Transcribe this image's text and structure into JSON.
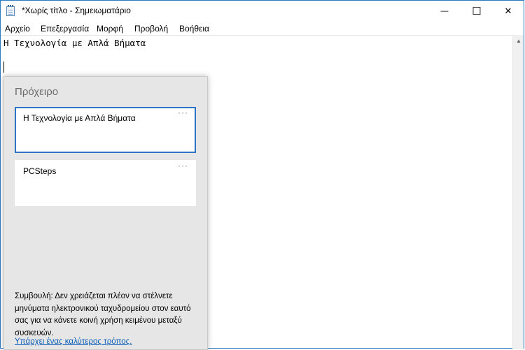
{
  "window": {
    "title": "*Χωρίς τίτλο - Σημειωματάριο",
    "minimize_glyph": "—",
    "maximize_glyph": "☐",
    "close_glyph": "✕"
  },
  "menu": {
    "items": [
      {
        "label": "Αρχείο"
      },
      {
        "label": "Επεξεργασία"
      },
      {
        "label": "Μορφή"
      },
      {
        "label": "Προβολή"
      },
      {
        "label": "Βοήθεια"
      }
    ]
  },
  "editor": {
    "content": "Η Τεχνολογία με Απλά Βήματα"
  },
  "clipboard": {
    "title": "Πρόχειρο",
    "items": [
      {
        "text": "Η Τεχνολογία με Απλά Βήματα",
        "more": "···",
        "selected": true
      },
      {
        "text": "PCSteps",
        "more": "···",
        "selected": false
      }
    ],
    "tip": "Συμβουλή: Δεν χρειάζεται πλέον να στέλνετε μηνύματα ηλεκτρονικού ταχυδρομείου στον εαυτό σας για να κάνετε κοινή χρήση κειμένου μεταξύ συσκευών.",
    "link": "Υπάρχει ένας καλύτερος τρόπος."
  },
  "colors": {
    "accent": "#2c74c8",
    "link": "#0a5db8",
    "panel_bg": "#e6e6e6"
  },
  "icons": {
    "app": "notepad-icon",
    "scroll_up": "scroll-up-arrow-icon"
  }
}
